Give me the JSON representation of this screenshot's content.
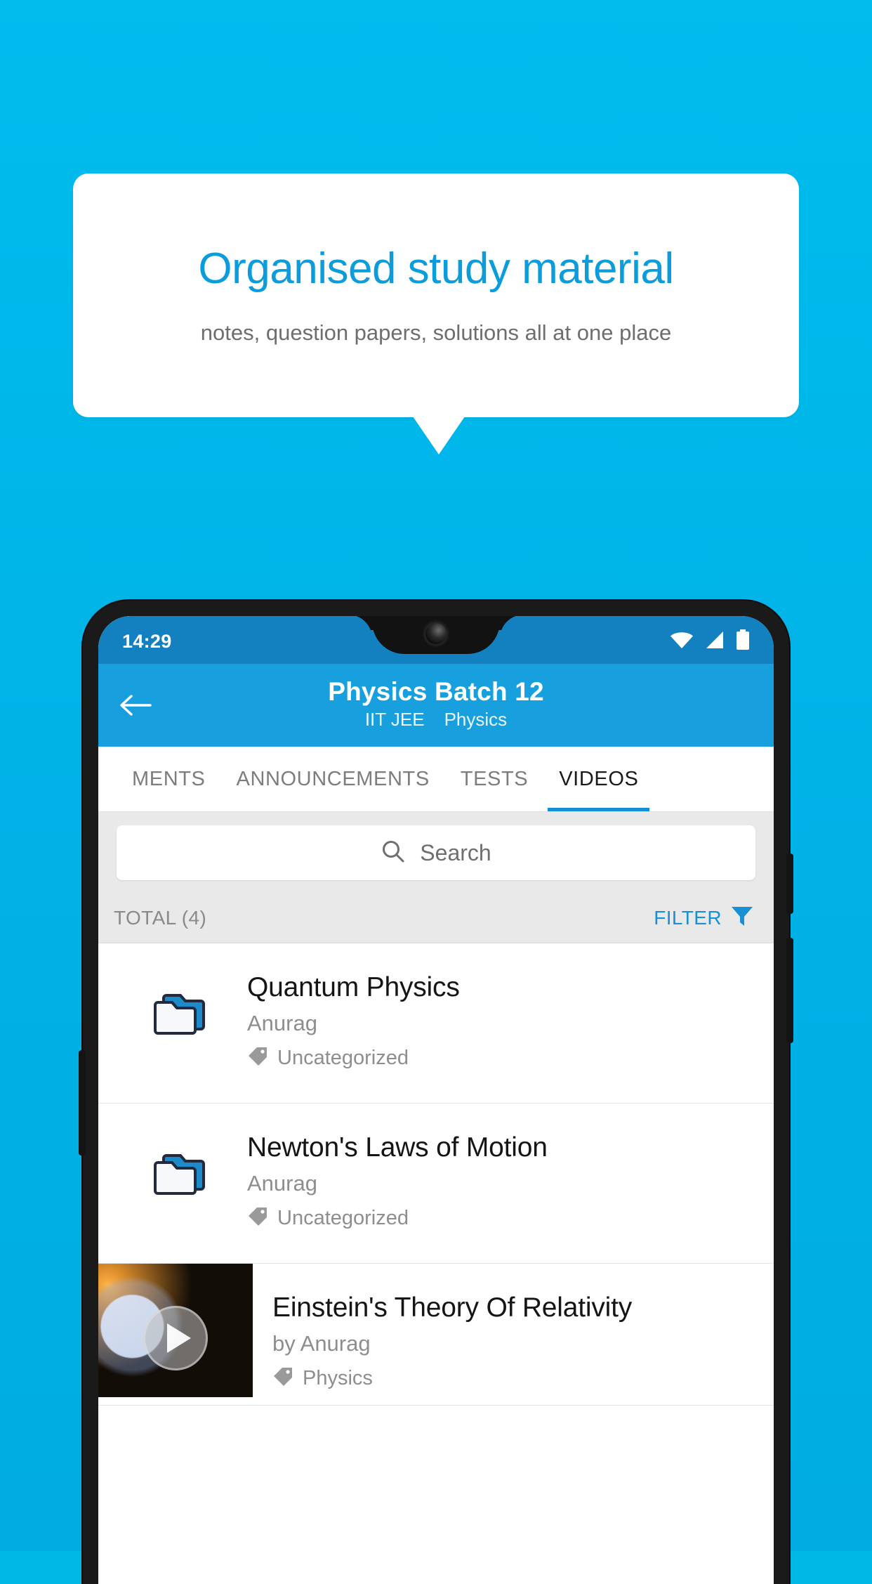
{
  "promo": {
    "headline": "Organised study material",
    "subhead": "notes, question papers, solutions all at one place",
    "headline_color": "#0b9ddb",
    "bg_color": "#00b4e8"
  },
  "phone": {
    "statusbar": {
      "time": "14:29",
      "icons": [
        "wifi-icon",
        "signal-icon",
        "battery-icon"
      ]
    },
    "appbar": {
      "back_icon": "back-arrow-icon",
      "title": "Physics Batch 12",
      "subtitle_exam": "IIT JEE",
      "subtitle_subject": "Physics",
      "color": "#17a0dd"
    },
    "tabs": [
      {
        "label": "MENTS",
        "active": false
      },
      {
        "label": "ANNOUNCEMENTS",
        "active": false
      },
      {
        "label": "TESTS",
        "active": false
      },
      {
        "label": "VIDEOS",
        "active": true
      }
    ],
    "search": {
      "placeholder": "Search",
      "icon": "search-icon"
    },
    "listheader": {
      "total": "TOTAL (4)",
      "filter_label": "FILTER",
      "filter_icon": "filter-funnel-icon",
      "filter_color": "#1790d6"
    },
    "items": [
      {
        "type": "folder",
        "icon": "folder-icon",
        "title": "Quantum Physics",
        "author": "Anurag",
        "tag": "Uncategorized",
        "tag_icon": "tag-icon"
      },
      {
        "type": "folder",
        "icon": "folder-icon",
        "title": "Newton's Laws of Motion",
        "author": "Anurag",
        "tag": "Uncategorized",
        "tag_icon": "tag-icon"
      },
      {
        "type": "video",
        "icon": "video-thumbnail",
        "play_icon": "play-icon",
        "title": "Einstein's Theory Of Relativity",
        "author": "by Anurag",
        "tag": "Physics",
        "tag_icon": "tag-icon"
      }
    ]
  }
}
